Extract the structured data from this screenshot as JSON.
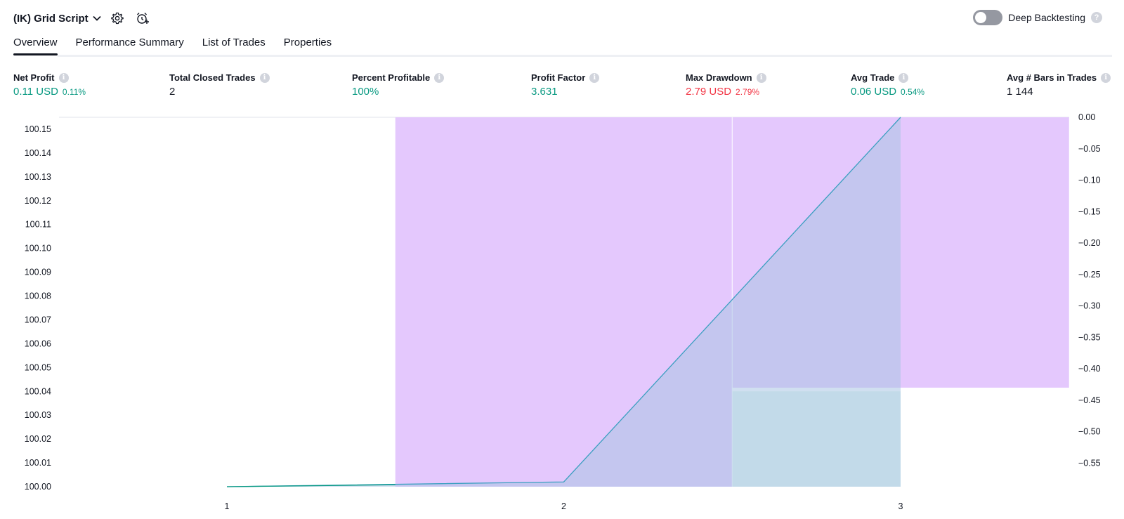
{
  "header": {
    "title": "(IK) Grid Script",
    "settings_icon": "gear-icon",
    "alert_icon": "alarm-clock-plus-icon"
  },
  "deep_backtesting": {
    "label": "Deep Backtesting",
    "enabled": false,
    "help": "?"
  },
  "tabs": [
    {
      "label": "Overview",
      "active": true
    },
    {
      "label": "Performance Summary",
      "active": false
    },
    {
      "label": "List of Trades",
      "active": false
    },
    {
      "label": "Properties",
      "active": false
    }
  ],
  "stats": [
    {
      "label": "Net Profit",
      "value": "0.11 USD",
      "pct": "0.11%",
      "color": "green"
    },
    {
      "label": "Total Closed Trades",
      "value": "2",
      "pct": "",
      "color": "dark"
    },
    {
      "label": "Percent Profitable",
      "value": "100%",
      "pct": "",
      "color": "green"
    },
    {
      "label": "Profit Factor",
      "value": "3.631",
      "pct": "",
      "color": "green"
    },
    {
      "label": "Max Drawdown",
      "value": "2.79 USD",
      "pct": "2.79%",
      "color": "red"
    },
    {
      "label": "Avg Trade",
      "value": "0.06 USD",
      "pct": "0.54%",
      "color": "green"
    },
    {
      "label": "Avg # Bars in Trades",
      "value": "1 144",
      "pct": "",
      "color": "dark"
    }
  ],
  "colors": {
    "equity_line": "#3a9fc0",
    "equity_fill": "#a9c4e3",
    "drawdown_bar": "#e3c5fd",
    "buyhold_bar": "#dff4ef",
    "positive": "#089981",
    "negative": "#f23645"
  },
  "chart_data": {
    "type": "line",
    "x_ticks": [
      "1",
      "2",
      "3"
    ],
    "left_axis": {
      "ticks": [
        "100.15",
        "100.14",
        "100.13",
        "100.12",
        "100.11",
        "100.10",
        "100.09",
        "100.08",
        "100.07",
        "100.06",
        "100.05",
        "100.04",
        "100.03",
        "100.02",
        "100.01",
        "100.00"
      ],
      "ylim": [
        100.0,
        100.155
      ]
    },
    "right_axis": {
      "ticks": [
        "0.00",
        "−0.05",
        "−0.10",
        "−0.15",
        "−0.20",
        "−0.25",
        "−0.30",
        "−0.35",
        "−0.40",
        "−0.45",
        "−0.50",
        "−0.55"
      ],
      "ylim": [
        -0.5875,
        0
      ]
    },
    "equity": {
      "x": [
        1,
        2,
        3
      ],
      "y": [
        100.0,
        100.002,
        100.155
      ]
    },
    "drawdown_bars": [
      {
        "x_from": 1.5,
        "x_to": 2.5,
        "value": -0.5875
      },
      {
        "x_from": 2.5,
        "x_to": 3.5,
        "value": -0.43
      }
    ],
    "buyhold_bars": [
      {
        "x_from": 2.5,
        "x_to": 3.0,
        "y_top": 100.04
      }
    ]
  }
}
